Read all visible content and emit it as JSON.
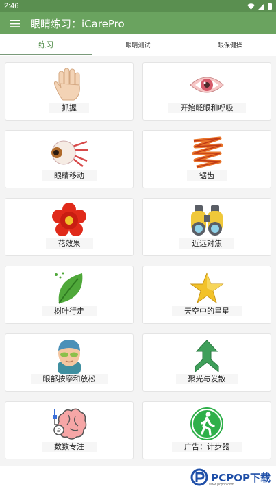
{
  "status_bar": {
    "time": "2:46"
  },
  "app_bar": {
    "title": "眼睛练习：iCarePro"
  },
  "tabs": [
    {
      "label": "练习",
      "active": true
    },
    {
      "label": "眼睛测试",
      "active": false
    },
    {
      "label": "眼保健操",
      "active": false
    }
  ],
  "cards": [
    {
      "label": "抓握",
      "icon": "hand-icon"
    },
    {
      "label": "开始眨眼和呼吸",
      "icon": "eye-icon"
    },
    {
      "label": "眼睛移动",
      "icon": "eyeball-icon"
    },
    {
      "label": "锯齿",
      "icon": "zigzag-icon"
    },
    {
      "label": "花效果",
      "icon": "flower-icon"
    },
    {
      "label": "近远对焦",
      "icon": "binoculars-icon"
    },
    {
      "label": "树叶行走",
      "icon": "leaf-icon"
    },
    {
      "label": "天空中的星星",
      "icon": "star-icon"
    },
    {
      "label": "眼部按摩和放松",
      "icon": "face-mask-icon"
    },
    {
      "label": "聚光与发散",
      "icon": "arrows-icon"
    },
    {
      "label": "数数专注",
      "icon": "brain-icon"
    },
    {
      "label": "广告：计步器",
      "icon": "walking-icon"
    }
  ],
  "watermark": {
    "text": "PCPOP下载",
    "sub": "www.pcpop.com"
  },
  "colors": {
    "app_bar": "#6aa35f",
    "status_bar": "#5a8f50",
    "active_tab": "#4d8a45"
  }
}
